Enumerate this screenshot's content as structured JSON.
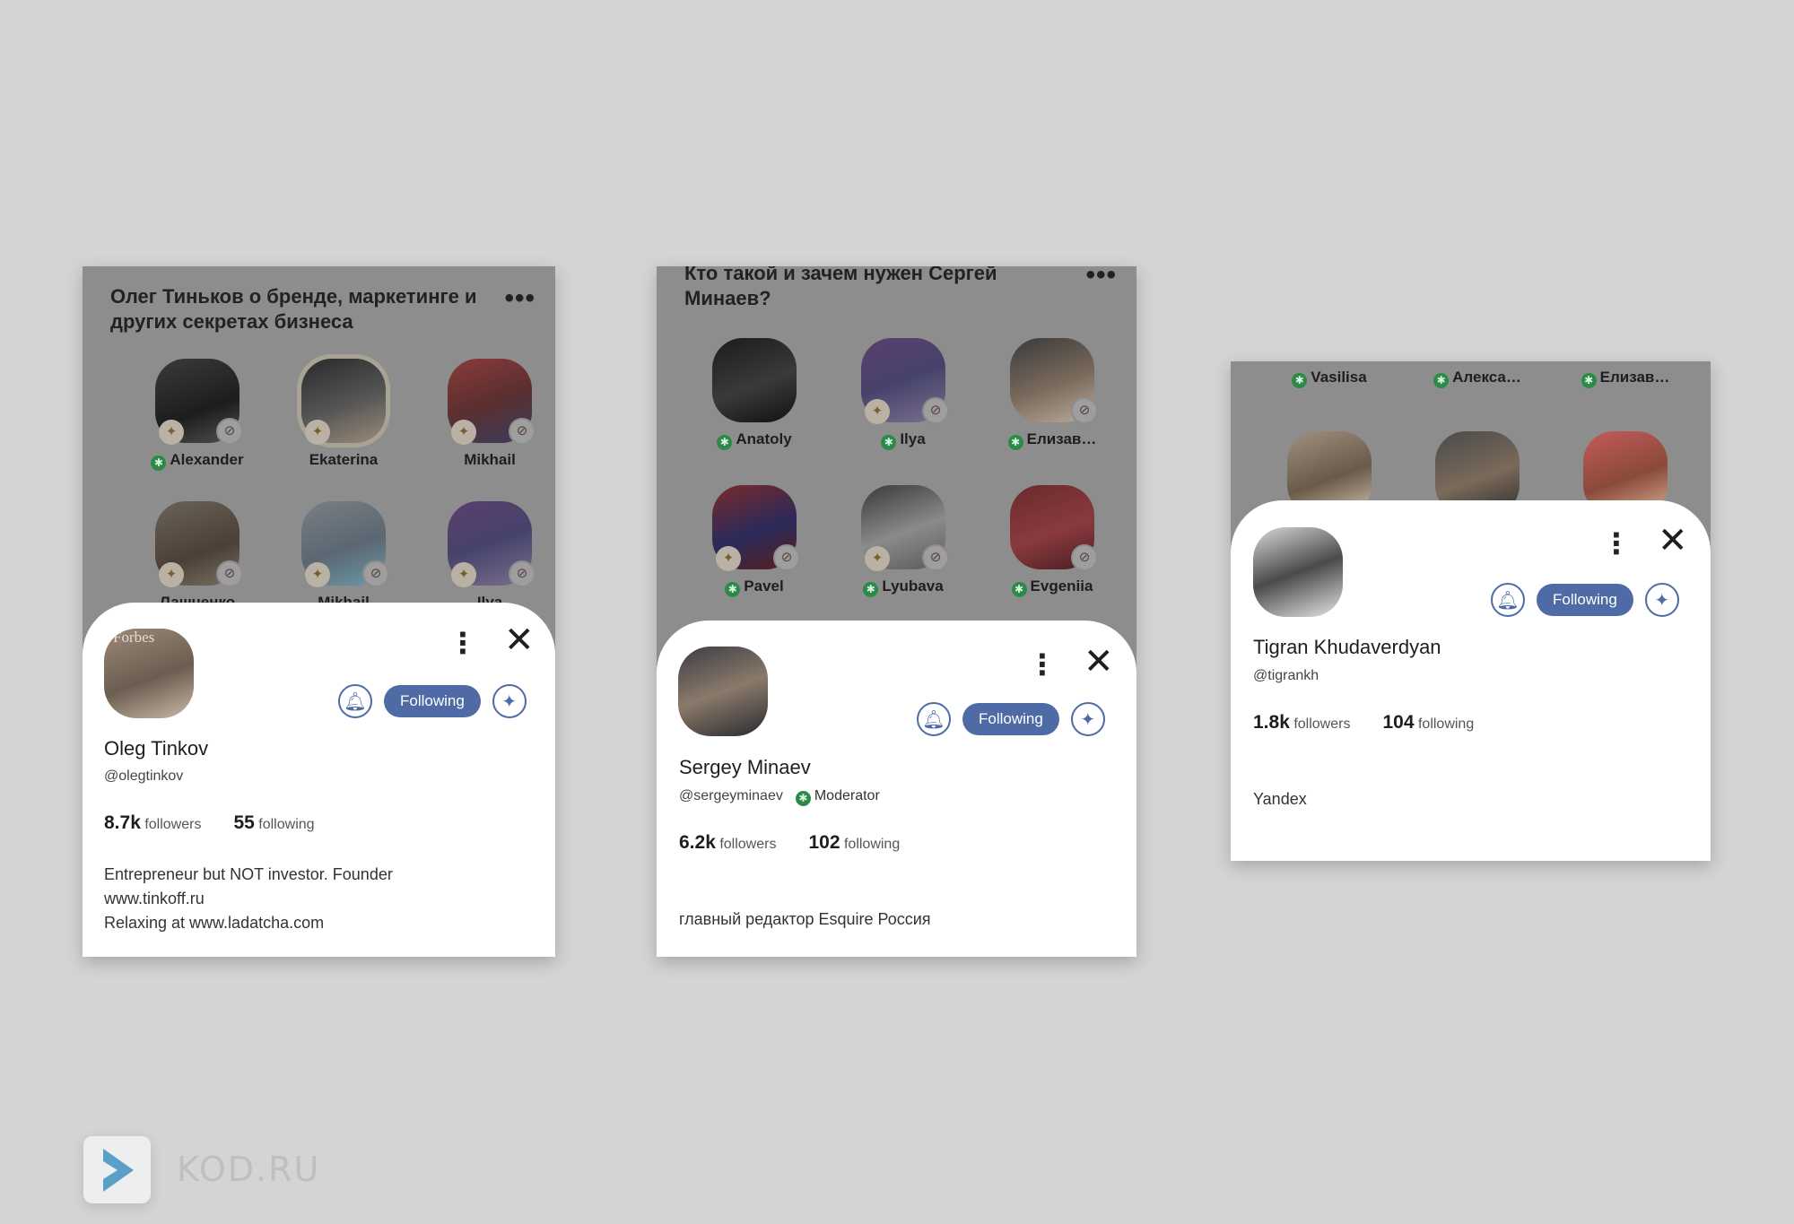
{
  "screens": [
    {
      "room_title": "Олег Тиньков о бренде, маркетинге и других секретах бизнеса",
      "room_more": "•••",
      "speakers": [
        {
          "name": "Alexander",
          "moderator": true
        },
        {
          "name": "Ekaterina",
          "moderator": false
        },
        {
          "name": "Mikhail",
          "moderator": false
        },
        {
          "name": "Лашченко",
          "moderator": false
        },
        {
          "name": "Mikhail",
          "moderator": false
        },
        {
          "name": "Ilya",
          "moderator": false
        }
      ],
      "profile": {
        "name": "Oleg Tinkov",
        "handle": "@olegtinkov",
        "role": "",
        "followers_count": "8.7k",
        "followers_label": "followers",
        "following_count": "55",
        "following_label": "following",
        "follow_button": "Following",
        "bio": "Entrepreneur but NOT investor.  Founder\nwww.tinkoff.ru\nRelaxing at www.ladatcha.com",
        "avatar_text": "Forbes"
      }
    },
    {
      "room_title": "Кто такой и зачем нужен Сергей Минаев?",
      "room_more": "•••",
      "speakers": [
        {
          "name": "Anatoly",
          "moderator": true
        },
        {
          "name": "Ilya",
          "moderator": true
        },
        {
          "name": "Елизав…",
          "moderator": true
        },
        {
          "name": "Pavel",
          "moderator": true
        },
        {
          "name": "Lyubava",
          "moderator": true
        },
        {
          "name": "Evgeniia",
          "moderator": true
        }
      ],
      "profile": {
        "name": "Sergey Minaev",
        "handle": "@sergeyminaev",
        "role": "Moderator",
        "followers_count": "6.2k",
        "followers_label": "followers",
        "following_count": "102",
        "following_label": "following",
        "follow_button": "Following",
        "bio": "главный редактор Esquire Россия"
      }
    },
    {
      "speakers": [
        {
          "name": "Vasilisa",
          "moderator": true
        },
        {
          "name": "Алекса…",
          "moderator": true
        },
        {
          "name": "Елизав…",
          "moderator": true
        }
      ],
      "profile": {
        "name": "Tigran Khudaverdyan",
        "handle": "@tigrankh",
        "role": "",
        "followers_count": "1.8k",
        "followers_label": "followers",
        "following_count": "104",
        "following_label": "following",
        "follow_button": "Following",
        "bio": "Yandex"
      }
    }
  ],
  "brand": {
    "text": "KOD.RU"
  },
  "icons": {
    "bell": "bell-icon",
    "sparkle": "sparkle-icon",
    "more": "more-vertical-icon",
    "close": "close-icon",
    "mic_off": "mic-off-icon",
    "party": "party-popper-icon",
    "moderator": "moderator-star-icon"
  },
  "colors": {
    "accent": "#4f6ba6",
    "moderator": "#2c8a48",
    "overlay": "#8d8d8d",
    "page_background": "#d4d4d4"
  }
}
